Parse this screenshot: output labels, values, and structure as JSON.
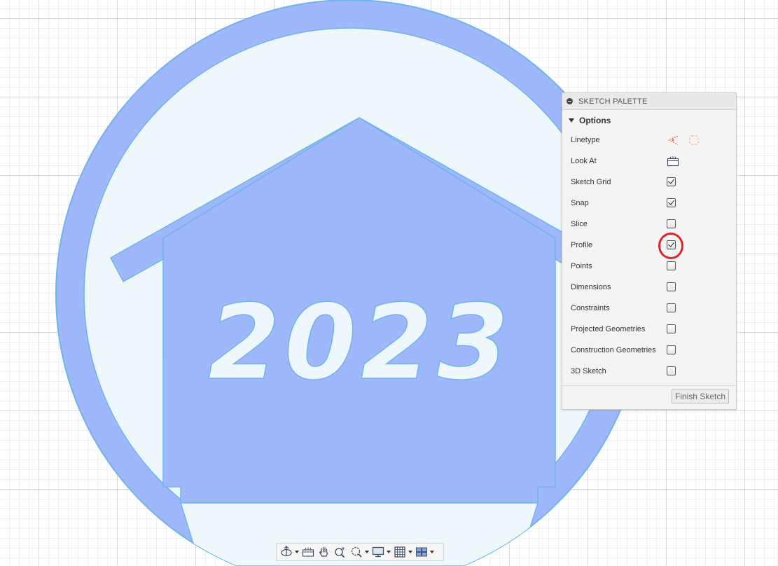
{
  "canvas": {
    "sketch_text": "2023",
    "colors": {
      "profile_fill": "#9fb7fb",
      "region_fill": "#eef7fc",
      "sketch_line": "#6fb4e8"
    }
  },
  "palette": {
    "title": "SKETCH PALETTE",
    "section": "Options",
    "rows": [
      {
        "label": "Linetype",
        "control": "linetype-icons"
      },
      {
        "label": "Look At",
        "control": "look-at-icon"
      },
      {
        "label": "Sketch Grid",
        "checked": true
      },
      {
        "label": "Snap",
        "checked": true
      },
      {
        "label": "Slice",
        "checked": false
      },
      {
        "label": "Profile",
        "checked": true
      },
      {
        "label": "Points",
        "checked": false
      },
      {
        "label": "Dimensions",
        "checked": false
      },
      {
        "label": "Constraints",
        "checked": false
      },
      {
        "label": "Projected Geometries",
        "checked": false
      },
      {
        "label": "Construction Geometries",
        "checked": false
      },
      {
        "label": "3D Sketch",
        "checked": false
      }
    ],
    "finish_button": "Finish Sketch",
    "highlight_color": "#e1222b"
  },
  "toolbar": {
    "buttons": [
      {
        "icon": "orbit-icon",
        "dropdown": true
      },
      {
        "icon": "look-at-icon",
        "dropdown": false
      },
      {
        "icon": "pan-hand-icon",
        "dropdown": false
      },
      {
        "icon": "zoom-icon",
        "dropdown": false
      },
      {
        "icon": "fit-zoom-icon",
        "dropdown": true
      },
      {
        "icon": "display-settings-icon",
        "dropdown": true
      },
      {
        "icon": "grid-snaps-icon",
        "dropdown": true
      },
      {
        "icon": "viewports-icon",
        "dropdown": true
      }
    ]
  }
}
